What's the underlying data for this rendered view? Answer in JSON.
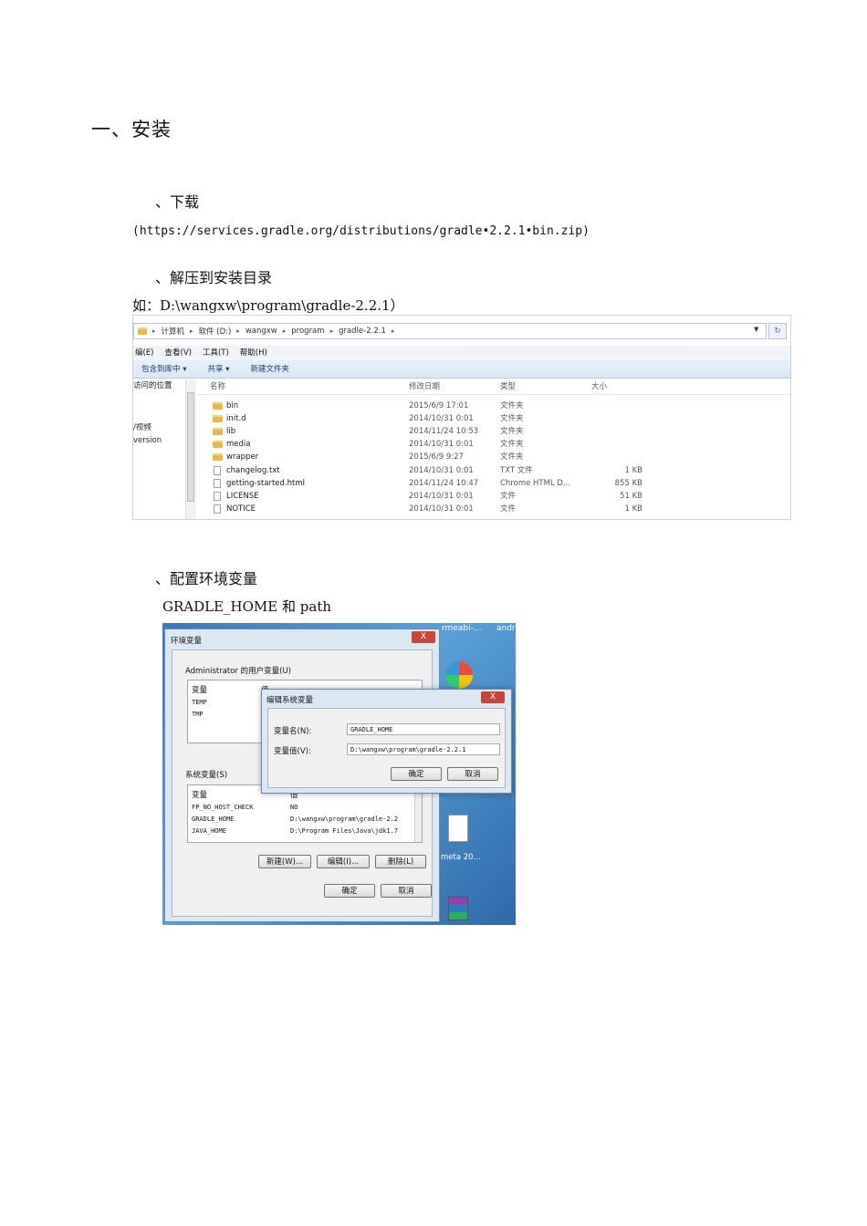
{
  "doc": {
    "section_title": "一、安装",
    "step1": "、下载",
    "download_url": "(https://services.gradle.org/distributions/gradle•2.2.1•bin.zip)",
    "step2": "、解压到安装目录",
    "install_example": "如：D:\\wangxw\\program\\gradle-2.2.1）",
    "step3": "、配置环境变量",
    "env_note": "GRADLE_HOME 和 path"
  },
  "explorer": {
    "crumbs": [
      "计算机",
      "软件 (D:)",
      "wangxw",
      "program",
      "gradle-2.2.1"
    ],
    "menu": [
      "编(E)",
      "查看(V)",
      "工具(T)",
      "帮助(H)"
    ],
    "toolbar": [
      "包含到库中 ▾",
      "共享 ▾",
      "新建文件夹"
    ],
    "nav": [
      "访问的位置",
      "/视频",
      "version"
    ],
    "columns": {
      "name": "名称",
      "date": "修改日期",
      "type": "类型",
      "size": "大小"
    },
    "rows": [
      {
        "name": "bin",
        "date": "2015/6/9 17:01",
        "type": "文件夹",
        "size": "",
        "kind": "folder"
      },
      {
        "name": "init.d",
        "date": "2014/10/31 0:01",
        "type": "文件夹",
        "size": "",
        "kind": "folder"
      },
      {
        "name": "lib",
        "date": "2014/11/24 10:53",
        "type": "文件夹",
        "size": "",
        "kind": "folder"
      },
      {
        "name": "media",
        "date": "2014/10/31 0:01",
        "type": "文件夹",
        "size": "",
        "kind": "folder"
      },
      {
        "name": "wrapper",
        "date": "2015/6/9 9:27",
        "type": "文件夹",
        "size": "",
        "kind": "folder"
      },
      {
        "name": "changelog.txt",
        "date": "2014/10/31 0:01",
        "type": "TXT 文件",
        "size": "1 KB",
        "kind": "file"
      },
      {
        "name": "getting-started.html",
        "date": "2014/11/24 10:47",
        "type": "Chrome HTML D...",
        "size": "855 KB",
        "kind": "file"
      },
      {
        "name": "LICENSE",
        "date": "2014/10/31 0:01",
        "type": "文件",
        "size": "51 KB",
        "kind": "file"
      },
      {
        "name": "NOTICE",
        "date": "2014/10/31 0:01",
        "type": "文件",
        "size": "1 KB",
        "kind": "file"
      }
    ]
  },
  "env": {
    "top_texts": [
      "rmeabi-...",
      "andr"
    ],
    "window_title": "环境变量",
    "user_vars_label": "Administrator 的用户变量(U)",
    "col_var": "变量",
    "col_val": "值",
    "user_vars": [
      "TEMP",
      "TMP"
    ],
    "sys_vars_label": "系统变量(S)",
    "sys_vars": [
      {
        "name": "FP_NO_HOST_CHECK",
        "value": "NO"
      },
      {
        "name": "GRADLE_HOME",
        "value": "D:\\wangxw\\program\\gradle-2.2"
      },
      {
        "name": "JAVA_HOME",
        "value": "D:\\Program Files\\Java\\jdk1.7"
      }
    ],
    "btn_new": "新建(W)...",
    "btn_edit": "编辑(I)...",
    "btn_delete": "删除(L)",
    "btn_ok": "确定",
    "btn_cancel": "取消",
    "edit_title": "编辑系统变量",
    "field_name_label": "变量名(N):",
    "field_name_value": "GRADLE_HOME",
    "field_value_label": "变量值(V):",
    "field_value_value": "D:\\wangxw\\program\\gradle-2.2.1",
    "close": "X",
    "desktop_label": "meta 20..."
  }
}
